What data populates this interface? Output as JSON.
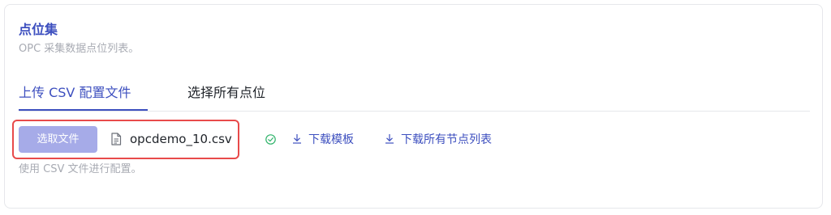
{
  "section": {
    "title": "点位集",
    "subtitle": "OPC 采集数据点位列表。"
  },
  "tabs": [
    {
      "label": "上传 CSV 配置文件",
      "active": true
    },
    {
      "label": "选择所有点位",
      "active": false
    }
  ],
  "upload": {
    "choose_button_label": "选取文件",
    "file_name": "opcdemo_10.csv",
    "status": "success",
    "hint": "使用 CSV 文件进行配置。"
  },
  "links": {
    "download_template": "下载模板",
    "download_all_nodes": "下载所有节点列表"
  },
  "icons": {
    "file": "file-icon",
    "success": "check-circle-icon",
    "download": "download-icon"
  },
  "colors": {
    "accent": "#3d4fbf",
    "button_disabled": "#a6abe8",
    "success": "#2fb36a",
    "highlight": "#e84a4a"
  }
}
